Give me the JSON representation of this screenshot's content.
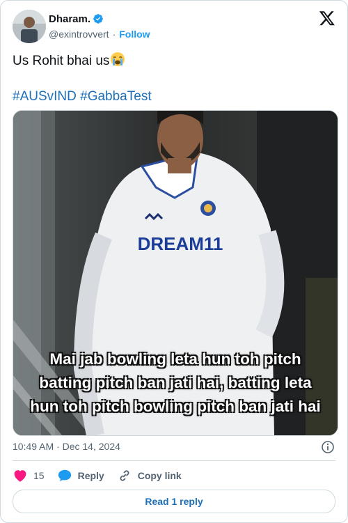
{
  "author": {
    "display_name": "Dharam.",
    "handle": "@exintrovvert",
    "separator": "·",
    "follow_label": "Follow"
  },
  "tweet": {
    "text": "Us Rohit bhai us",
    "hashtags": [
      "#AUSvIND",
      "#GabbaTest"
    ],
    "emoji": "loudly-crying-face-emoji"
  },
  "media": {
    "caption_lines": [
      "Mai jab bowling leta hun toh pitch",
      "batting pitch ban jati hai, batting leta",
      "hun toh pitch bowling pitch ban jati hai"
    ],
    "jersey_text": "DREAM11"
  },
  "meta": {
    "time": "10:49 AM",
    "separator": "·",
    "date": "Dec 14, 2024"
  },
  "actions": {
    "like_count": "15",
    "reply_label": "Reply",
    "copy_label": "Copy link"
  },
  "read_replies_label": "Read 1 reply",
  "colors": {
    "accent": "#1d9bf0",
    "link": "#1d6fb8",
    "like": "#f91880",
    "border": "#cfd9de",
    "muted": "#536471"
  }
}
